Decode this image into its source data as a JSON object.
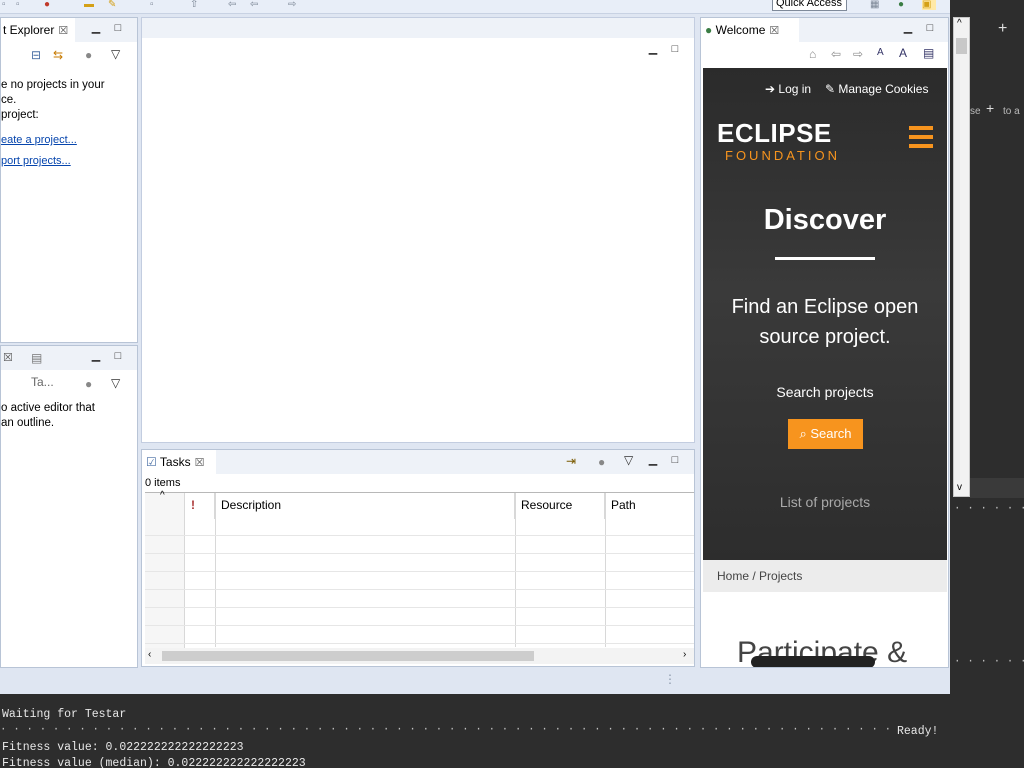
{
  "toolbar": {
    "quick_access": "Quick Access"
  },
  "project_explorer": {
    "tab_label": "t Explorer",
    "message_line1": "e no projects in your",
    "message_line2": "ce.",
    "message_line3": " project:",
    "link_create": "eate a project...",
    "link_import": "port projects..."
  },
  "outline": {
    "tab_label": "Ta...",
    "message_line1": "o active editor that",
    "message_line2": "an outline."
  },
  "tasks": {
    "tab_label": "Tasks",
    "count": "0 items",
    "columns": [
      "!",
      "Description",
      "Resource",
      "Path"
    ]
  },
  "welcome": {
    "tab_label": "Welcome",
    "login": "Log in",
    "manage_cookies": "Manage Cookies",
    "logo_text": "ECLIPSE",
    "logo_sub": "FOUNDATION",
    "discover": "Discover",
    "find_text": "Find an Eclipse open source project.",
    "search_projects": "Search projects",
    "search_button": "Search",
    "list_projects": "List of projects",
    "breadcrumb_home": "Home",
    "breadcrumb_sep": "/",
    "breadcrumb_projects": "Projects",
    "participate": "Participate &"
  },
  "right_pane": {
    "label": "se",
    "label2": "to a"
  },
  "console": {
    "line1": "Waiting for Testar",
    "ready": "Ready!",
    "line2": "Fitness value: 0.022222222222222223",
    "line3": "Fitness value (median): 0.022222222222222223"
  }
}
